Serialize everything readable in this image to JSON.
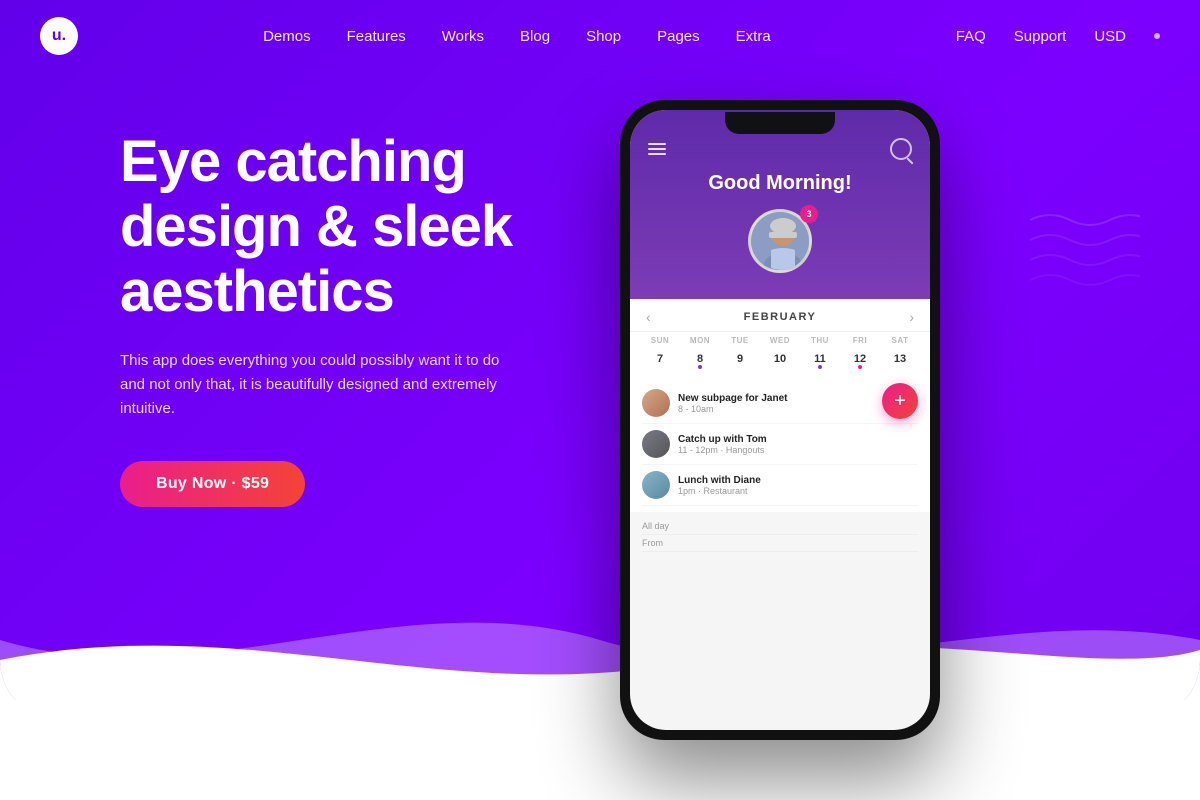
{
  "logo": {
    "text": "u.",
    "alt": "Logo"
  },
  "nav": {
    "center_items": [
      "Demos",
      "Features",
      "Works",
      "Blog",
      "Shop",
      "Pages",
      "Extra"
    ],
    "right_items": [
      "FAQ",
      "Support",
      "USD"
    ]
  },
  "hero": {
    "title": "Eye catching design & sleek aesthetics",
    "description": "This app does everything you could possibly want it to do and not only that, it is beautifully designed and extremely intuitive.",
    "cta_label": "Buy Now · $59"
  },
  "phone": {
    "greeting": "Good Morning!",
    "avatar_badge": "3",
    "month": "FEBRUARY",
    "day_names": [
      "SUN",
      "MON",
      "TUE",
      "WED",
      "THU",
      "FRI",
      "SAT"
    ],
    "dates": [
      {
        "num": "7",
        "dot": ""
      },
      {
        "num": "8",
        "dot": "purple"
      },
      {
        "num": "9",
        "dot": ""
      },
      {
        "num": "10",
        "dot": ""
      },
      {
        "num": "11",
        "dot": "purple"
      },
      {
        "num": "12",
        "dot": "pink"
      },
      {
        "num": "13",
        "dot": ""
      }
    ],
    "events": [
      {
        "title": "New subpage for Janet",
        "time": "8 - 10am"
      },
      {
        "title": "Catch up with Tom",
        "time": "11 - 12pm · Hangouts"
      },
      {
        "title": "Lunch with Diane",
        "time": "1pm · Restaurant"
      }
    ],
    "form_rows": [
      "All day",
      "From"
    ]
  },
  "colors": {
    "bg_purple": "#6200ea",
    "accent_pink": "#e91e8c",
    "white": "#ffffff"
  }
}
